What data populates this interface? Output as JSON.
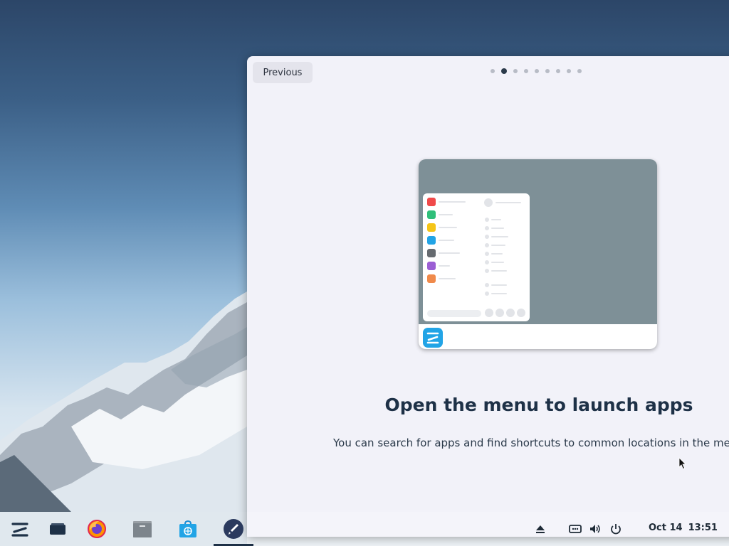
{
  "window": {
    "previous_label": "Previous",
    "page_dots_total": 9,
    "page_dots_active_index": 1,
    "title": "Open the menu to launch apps",
    "description": "You can search for apps and find shortcuts to common locations in the menu."
  },
  "illustration": {
    "category_colors": [
      "#f04a4a",
      "#2fbf7a",
      "#f5c518",
      "#22a4e6",
      "#666b70",
      "#9b5fd4",
      "#f08a4b"
    ],
    "background_color": "#7e9097"
  },
  "taskbar": {
    "apps": [
      {
        "name": "zorin-menu-icon"
      },
      {
        "name": "desktop-workspace-icon"
      },
      {
        "name": "firefox-icon"
      },
      {
        "name": "files-icon"
      },
      {
        "name": "software-store-icon"
      },
      {
        "name": "welcome-tour-icon",
        "active": true
      }
    ],
    "tray": [
      "eject-icon",
      "network-icon",
      "volume-icon",
      "power-icon"
    ],
    "clock": {
      "date": "Oct 14",
      "time": "13:51"
    }
  },
  "colors": {
    "accent": "#22a4e6",
    "heading": "#1e3147",
    "window_bg": "#f2f2f9"
  }
}
